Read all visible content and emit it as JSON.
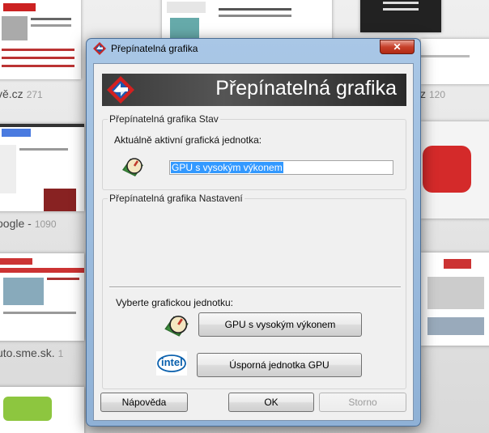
{
  "background": {
    "tiles": [
      {
        "caption": "vě.cz",
        "count": "271"
      },
      {
        "caption": "zz",
        "count": "120"
      },
      {
        "caption": "oogle -",
        "count": "1090"
      },
      {
        "caption": "uto.sme.sk.",
        "count": "1"
      }
    ]
  },
  "dialog": {
    "title": "Přepínatelná grafika",
    "close_label": "✕",
    "banner_title": "Přepínatelná grafika",
    "status_group": {
      "legend": "Přepínatelná grafika Stav",
      "active_label": "Aktuálně aktivní grafická jednotka:",
      "active_value": "GPU s vysokým výkonem"
    },
    "settings_group": {
      "legend": "Přepínatelná grafika Nastavení",
      "select_label": "Vyberte grafickou jednotku:",
      "high_perf_button": "GPU s vysokým výkonem",
      "power_saving_button": "Úsporná jednotka GPU"
    },
    "intel_logo_text": "intel",
    "footer": {
      "help_button": "Nápověda",
      "ok_button": "OK",
      "cancel_button": "Storno"
    }
  },
  "colors": {
    "selection": "#3399ff",
    "close_red": "#c7402a",
    "banner_dark": "#3a3a3a"
  }
}
